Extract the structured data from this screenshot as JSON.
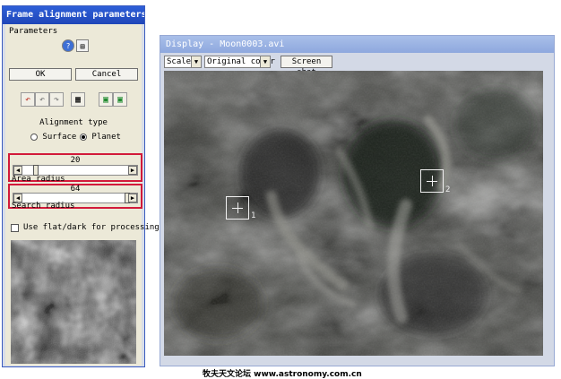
{
  "left_window": {
    "title": "Frame alignment parameters",
    "section_label": "Parameters",
    "ok_label": "OK",
    "cancel_label": "Cancel",
    "alignment_type_label": "Alignment type",
    "surface_label": "Surface",
    "planet_label": "Planet",
    "selected_alignment": "Planet",
    "area_radius": {
      "value": "20",
      "label": "Area radius"
    },
    "search_radius": {
      "value": "64",
      "label": "Search radius"
    },
    "use_flat_dark_label": "Use flat/dark for processing"
  },
  "display_window": {
    "title": "Display - Moon0003.avi",
    "scale_combo": "Scaled",
    "color_combo": "Original color",
    "screenshot_label": "Screen shot",
    "markers": [
      {
        "number": "1"
      },
      {
        "number": "2"
      }
    ]
  },
  "watermark": "牧夫天文论坛 www.astronomy.com.cn",
  "colors": {
    "highlight": "#d21a3a",
    "title_active": "#2e5fd8",
    "title_inactive": "#a9bfe9"
  }
}
